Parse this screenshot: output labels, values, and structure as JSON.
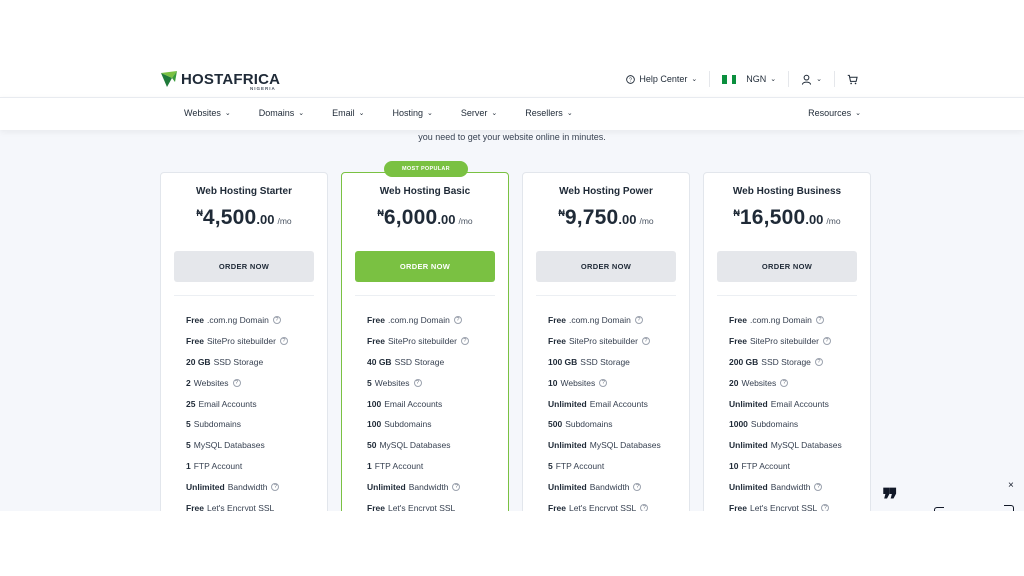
{
  "brand": {
    "name_part1": "HOST",
    "name_part2": "AFRICA",
    "country": "NIGERIA",
    "accent": "#7ac142"
  },
  "header": {
    "help_label": "Help Center",
    "currency_label": "NGN",
    "icons": [
      "help-icon",
      "user-icon",
      "cart-icon"
    ]
  },
  "nav": {
    "items": [
      "Websites",
      "Domains",
      "Email",
      "Hosting",
      "Server",
      "Resellers"
    ],
    "resources_label": "Resources"
  },
  "subtitle": "you need to get your website online in minutes.",
  "plans": [
    {
      "title": "Web Hosting Starter",
      "currency_symbol": "₦",
      "price_int": "4,500",
      "price_dec": ".00",
      "period": "/mo",
      "button": "ORDER NOW",
      "popular": false,
      "features": [
        {
          "bold": "Free",
          "text": ".com.ng Domain",
          "help": true
        },
        {
          "bold": "Free",
          "text": "SitePro sitebuilder",
          "help": true
        },
        {
          "bold": "20 GB",
          "text": "SSD Storage",
          "help": false
        },
        {
          "bold": "2",
          "text": "Websites",
          "help": true
        },
        {
          "bold": "25",
          "text": "Email Accounts",
          "help": false
        },
        {
          "bold": "5",
          "text": "Subdomains",
          "help": false
        },
        {
          "bold": "5",
          "text": "MySQL Databases",
          "help": false
        },
        {
          "bold": "1",
          "text": "FTP Account",
          "help": false
        },
        {
          "bold": "Unlimited",
          "text": "Bandwidth",
          "help": true
        },
        {
          "bold": "Free",
          "text": "Let's Encrypt SSL",
          "help": false
        }
      ]
    },
    {
      "title": "Web Hosting Basic",
      "currency_symbol": "₦",
      "price_int": "6,000",
      "price_dec": ".00",
      "period": "/mo",
      "button": "ORDER NOW",
      "popular": true,
      "badge": "MOST POPULAR",
      "features": [
        {
          "bold": "Free",
          "text": ".com.ng Domain",
          "help": true
        },
        {
          "bold": "Free",
          "text": "SitePro sitebuilder",
          "help": true
        },
        {
          "bold": "40 GB",
          "text": "SSD Storage",
          "help": false
        },
        {
          "bold": "5",
          "text": "Websites",
          "help": true
        },
        {
          "bold": "100",
          "text": "Email Accounts",
          "help": false
        },
        {
          "bold": "100",
          "text": "Subdomains",
          "help": false
        },
        {
          "bold": "50",
          "text": "MySQL Databases",
          "help": false
        },
        {
          "bold": "1",
          "text": "FTP Account",
          "help": false
        },
        {
          "bold": "Unlimited",
          "text": "Bandwidth",
          "help": true
        },
        {
          "bold": "Free",
          "text": "Let's Encrypt SSL",
          "help": false
        }
      ]
    },
    {
      "title": "Web Hosting Power",
      "currency_symbol": "₦",
      "price_int": "9,750",
      "price_dec": ".00",
      "period": "/mo",
      "button": "ORDER NOW",
      "popular": false,
      "features": [
        {
          "bold": "Free",
          "text": ".com.ng Domain",
          "help": true
        },
        {
          "bold": "Free",
          "text": "SitePro sitebuilder",
          "help": true
        },
        {
          "bold": "100 GB",
          "text": "SSD Storage",
          "help": false
        },
        {
          "bold": "10",
          "text": "Websites",
          "help": true
        },
        {
          "bold": "Unlimited",
          "text": "Email Accounts",
          "help": false
        },
        {
          "bold": "500",
          "text": "Subdomains",
          "help": false
        },
        {
          "bold": "Unlimited",
          "text": "MySQL Databases",
          "help": false
        },
        {
          "bold": "5",
          "text": "FTP Account",
          "help": false
        },
        {
          "bold": "Unlimited",
          "text": "Bandwidth",
          "help": true
        },
        {
          "bold": "Free",
          "text": "Let's Encrypt SSL",
          "help": true
        }
      ]
    },
    {
      "title": "Web Hosting Business",
      "currency_symbol": "₦",
      "price_int": "16,500",
      "price_dec": ".00",
      "period": "/mo",
      "button": "ORDER NOW",
      "popular": false,
      "features": [
        {
          "bold": "Free",
          "text": ".com.ng Domain",
          "help": true
        },
        {
          "bold": "Free",
          "text": "SitePro sitebuilder",
          "help": true
        },
        {
          "bold": "200 GB",
          "text": "SSD Storage",
          "help": true
        },
        {
          "bold": "20",
          "text": "Websites",
          "help": true
        },
        {
          "bold": "Unlimited",
          "text": "Email Accounts",
          "help": false
        },
        {
          "bold": "1000",
          "text": "Subdomains",
          "help": false
        },
        {
          "bold": "Unlimited",
          "text": "MySQL Databases",
          "help": false
        },
        {
          "bold": "10",
          "text": "FTP Account",
          "help": false
        },
        {
          "bold": "Unlimited",
          "text": "Bandwidth",
          "help": true
        },
        {
          "bold": "Free",
          "text": "Let's Encrypt SSL",
          "help": true
        }
      ]
    }
  ],
  "widget": {
    "close_glyph": "×",
    "quote_glyph": "❞"
  }
}
